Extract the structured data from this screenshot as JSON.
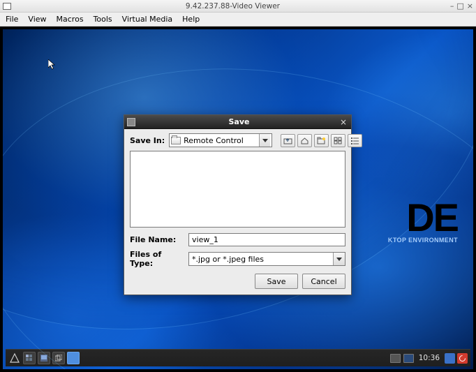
{
  "app": {
    "title": "9.42.237.88-Video Viewer",
    "menu": {
      "items": [
        "File",
        "View",
        "Macros",
        "Tools",
        "Virtual Media",
        "Help"
      ]
    }
  },
  "desktop": {
    "brand_big": "DE",
    "brand_small": "KTOP ENVIRONMENT"
  },
  "dialog": {
    "title": "Save",
    "save_in_label": "Save In:",
    "save_in_value": "Remote Control",
    "file_name_label": "File Name:",
    "file_name_value": "view_1",
    "file_type_label": "Files of Type:",
    "file_type_value": "*.jpg or *.jpeg files",
    "save_button": "Save",
    "cancel_button": "Cancel",
    "toolbar_icons": [
      "up-one-level-icon",
      "home-icon",
      "new-folder-icon",
      "list-view-icon",
      "details-view-icon"
    ]
  },
  "taskbar": {
    "clock": "10:36"
  }
}
